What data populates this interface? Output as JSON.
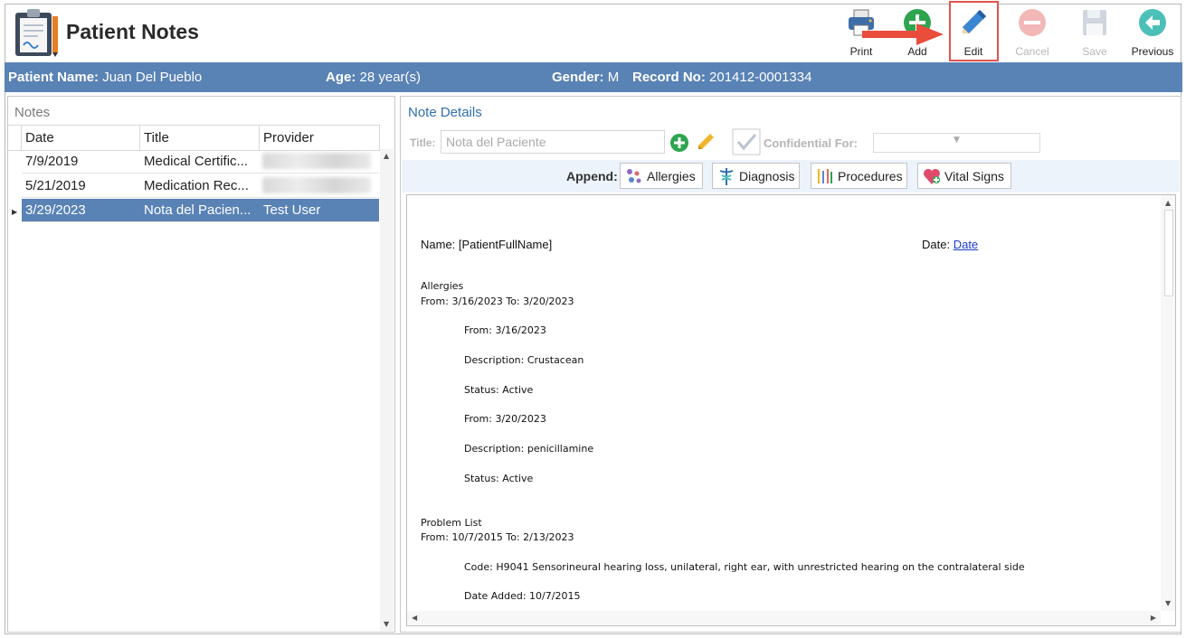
{
  "app": {
    "title": "Patient Notes"
  },
  "toolbar": {
    "print": "Print",
    "add": "Add",
    "edit": "Edit",
    "cancel": "Cancel",
    "save": "Save",
    "previous": "Previous"
  },
  "patient": {
    "name_label": "Patient Name:",
    "name": "Juan Del Pueblo",
    "age_label": "Age:",
    "age": "28 year(s)",
    "gender_label": "Gender:",
    "gender": "M",
    "record_label": "Record No:",
    "record": "201412-0001334"
  },
  "notes": {
    "title": "Notes",
    "columns": [
      "Date",
      "Title",
      "Provider"
    ],
    "rows": [
      {
        "date": "7/9/2019",
        "title": "Medical Certific...",
        "provider": ""
      },
      {
        "date": "5/21/2019",
        "title": "Medication Rec...",
        "provider": ""
      },
      {
        "date": "3/29/2023",
        "title": "Nota del Pacien...",
        "provider": "Test User"
      }
    ]
  },
  "details": {
    "title": "Note Details",
    "title_label": "Title:",
    "title_placeholder": "Nota del Paciente",
    "confidential_label": "Confidential For:",
    "append_label": "Append:",
    "append_buttons": [
      "Allergies",
      "Diagnosis",
      "Procedures",
      "Vital Signs"
    ]
  },
  "document": {
    "name_line": "Name: [PatientFullName]",
    "date_label": "Date:",
    "date_link": "Date",
    "lines": [
      "Allergies",
      "From: 3/16/2023 To: 3/20/2023",
      "From: 3/16/2023",
      "Description: Crustacean",
      "Status: Active",
      "From: 3/20/2023",
      "Description: penicillamine",
      "Status: Active",
      "Problem List",
      "From: 10/7/2015 To: 2/13/2023",
      "Code: H9041 Sensorineural hearing loss, unilateral, right ear, with unrestricted hearing on the contralateral side",
      "Date Added: 10/7/2015"
    ]
  },
  "colors": {
    "header_bar": "#5982b5",
    "accent_link": "#2f6fb0",
    "highlight_box": "#e2544e"
  }
}
